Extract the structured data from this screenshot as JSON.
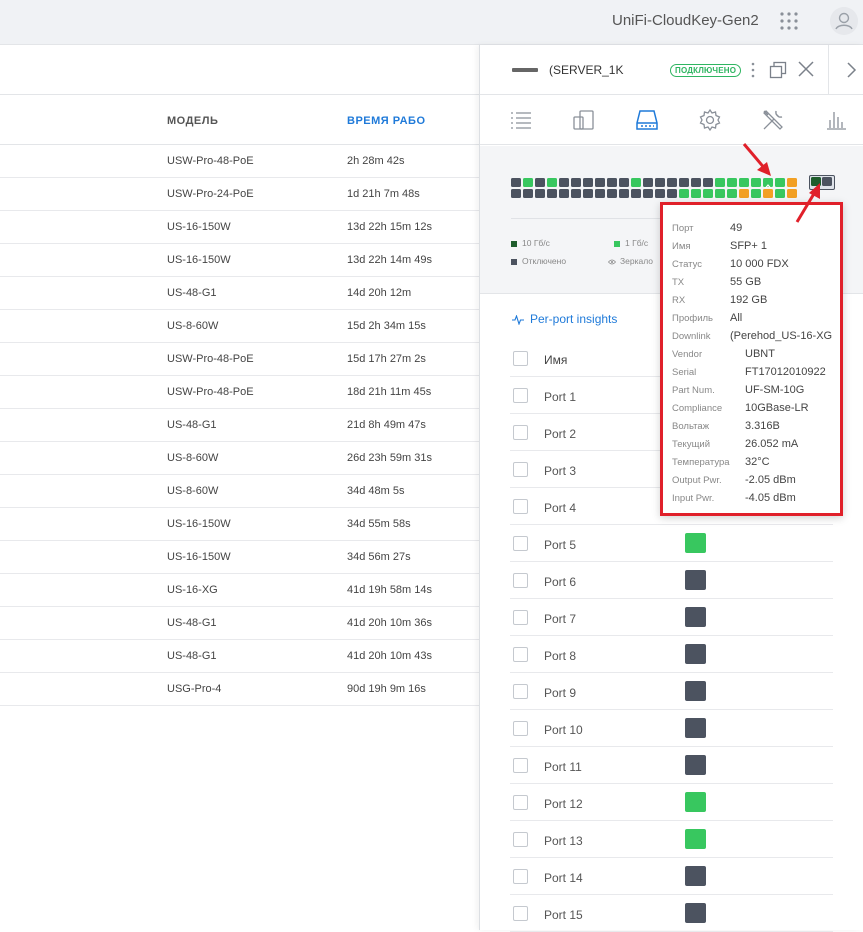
{
  "topbar": {
    "controller_name": "UniFi-CloudKey-Gen2"
  },
  "device_table": {
    "columns": {
      "model": "МОДЕЛЬ",
      "uptime": "ВРЕМЯ РАБО"
    },
    "rows": [
      {
        "model": "USW-Pro-48-PoE",
        "uptime": "2h 28m 42s"
      },
      {
        "model": "USW-Pro-24-PoE",
        "uptime": "1d 21h 7m 48s"
      },
      {
        "model": "US-16-150W",
        "uptime": "13d 22h 15m 12s"
      },
      {
        "model": "US-16-150W",
        "uptime": "13d 22h 14m 49s"
      },
      {
        "model": "US-48-G1",
        "uptime": "14d 20h 12m"
      },
      {
        "model": "US-8-60W",
        "uptime": "15d 2h 34m 15s"
      },
      {
        "model": "USW-Pro-48-PoE",
        "uptime": "15d 17h 27m 2s"
      },
      {
        "model": "USW-Pro-48-PoE",
        "uptime": "18d 21h 11m 45s"
      },
      {
        "model": "US-48-G1",
        "uptime": "21d 8h 49m 47s"
      },
      {
        "model": "US-8-60W",
        "uptime": "26d 23h 59m 31s"
      },
      {
        "model": "US-8-60W",
        "uptime": "34d 48m 5s"
      },
      {
        "model": "US-16-150W",
        "uptime": "34d 55m 58s"
      },
      {
        "model": "US-16-150W",
        "uptime": "34d 56m 27s"
      },
      {
        "model": "US-16-XG",
        "uptime": "41d 19h 58m 14s"
      },
      {
        "model": "US-48-G1",
        "uptime": "41d 20h 10m 36s"
      },
      {
        "model": "US-48-G1",
        "uptime": "41d 20h 10m 43s"
      },
      {
        "model": "USG-Pro-4",
        "uptime": "90d 19h 9m 16s"
      }
    ]
  },
  "panel": {
    "device_name": "(SERVER_1K",
    "status": "ПОДКЛЮЧЕНО",
    "tabs": [
      "list-icon",
      "devices-icon",
      "ports-icon",
      "settings-icon",
      "tools-icon",
      "stats-icon"
    ],
    "active_tab": "ports-icon",
    "legend": {
      "ten_g": "10 Гб/с",
      "one_g": "1 Гб/с",
      "disabled": "Отключено",
      "mirror": "Зеркало"
    },
    "insights_label": "Per-port insights",
    "list_header": "Имя",
    "ports": [
      {
        "name": "Port 1",
        "status": "green"
      },
      {
        "name": "Port 2",
        "status": "green"
      },
      {
        "name": "Port 3",
        "status": "green"
      },
      {
        "name": "Port 4",
        "status": "green"
      },
      {
        "name": "Port 5",
        "status": "green"
      },
      {
        "name": "Port 6",
        "status": "gray"
      },
      {
        "name": "Port 7",
        "status": "gray"
      },
      {
        "name": "Port 8",
        "status": "gray"
      },
      {
        "name": "Port 9",
        "status": "gray"
      },
      {
        "name": "Port 10",
        "status": "gray"
      },
      {
        "name": "Port 11",
        "status": "gray"
      },
      {
        "name": "Port 12",
        "status": "green"
      },
      {
        "name": "Port 13",
        "status": "green"
      },
      {
        "name": "Port 14",
        "status": "gray"
      },
      {
        "name": "Port 15",
        "status": "gray"
      }
    ]
  },
  "port_grid": {
    "top_row": [
      "gray",
      "green",
      "gray",
      "green",
      "gray",
      "gray",
      "gray",
      "gray",
      "gray",
      "gray",
      "green",
      "gray",
      "gray",
      "gray",
      "gray",
      "gray",
      "gray",
      "green",
      "green",
      "green",
      "green",
      "mirror",
      "green",
      "orange"
    ],
    "bottom_row": [
      "gray",
      "gray",
      "gray",
      "gray",
      "gray",
      "gray",
      "gray",
      "gray",
      "gray",
      "gray",
      "gray",
      "gray",
      "gray",
      "gray",
      "green",
      "green",
      "green",
      "green",
      "green",
      "orange",
      "green",
      "orange",
      "green",
      "orange"
    ],
    "sfp": [
      "darkgreen",
      "gray"
    ]
  },
  "tooltip": {
    "rows": [
      {
        "key": "Порт",
        "value": "49"
      },
      {
        "key": "Имя",
        "value": "SFP+ 1"
      },
      {
        "key": "Статус",
        "value": "10 000 FDX"
      },
      {
        "key": "TX",
        "value": "55 GB"
      },
      {
        "key": "RX",
        "value": "192 GB"
      },
      {
        "key": "Профиль",
        "value": "All"
      },
      {
        "key": "Downlink",
        "value": "(Perehod_US-16-XG"
      },
      {
        "key": "Vendor",
        "value": "UBNT"
      },
      {
        "key": "Serial",
        "value": "FT17012010922"
      },
      {
        "key": "Part Num.",
        "value": "UF-SM-10G"
      },
      {
        "key": "Compliance",
        "value": "10GBase-LR"
      },
      {
        "key": "Вольтаж",
        "value": "3.316В"
      },
      {
        "key": "Текущий",
        "value": "26.052 mA"
      },
      {
        "key": "Температура",
        "value": "32°C"
      },
      {
        "key": "Output Pwr.",
        "value": "-2.05 dBm"
      },
      {
        "key": "Input Pwr.",
        "value": "-4.05 dBm"
      }
    ]
  },
  "colors": {
    "green": "#38c75f",
    "darkgreen": "#1f5d2c",
    "gray": "#4c5360",
    "orange": "#f2a024",
    "accent": "#1f7ad9",
    "highlight": "#e0202a"
  }
}
